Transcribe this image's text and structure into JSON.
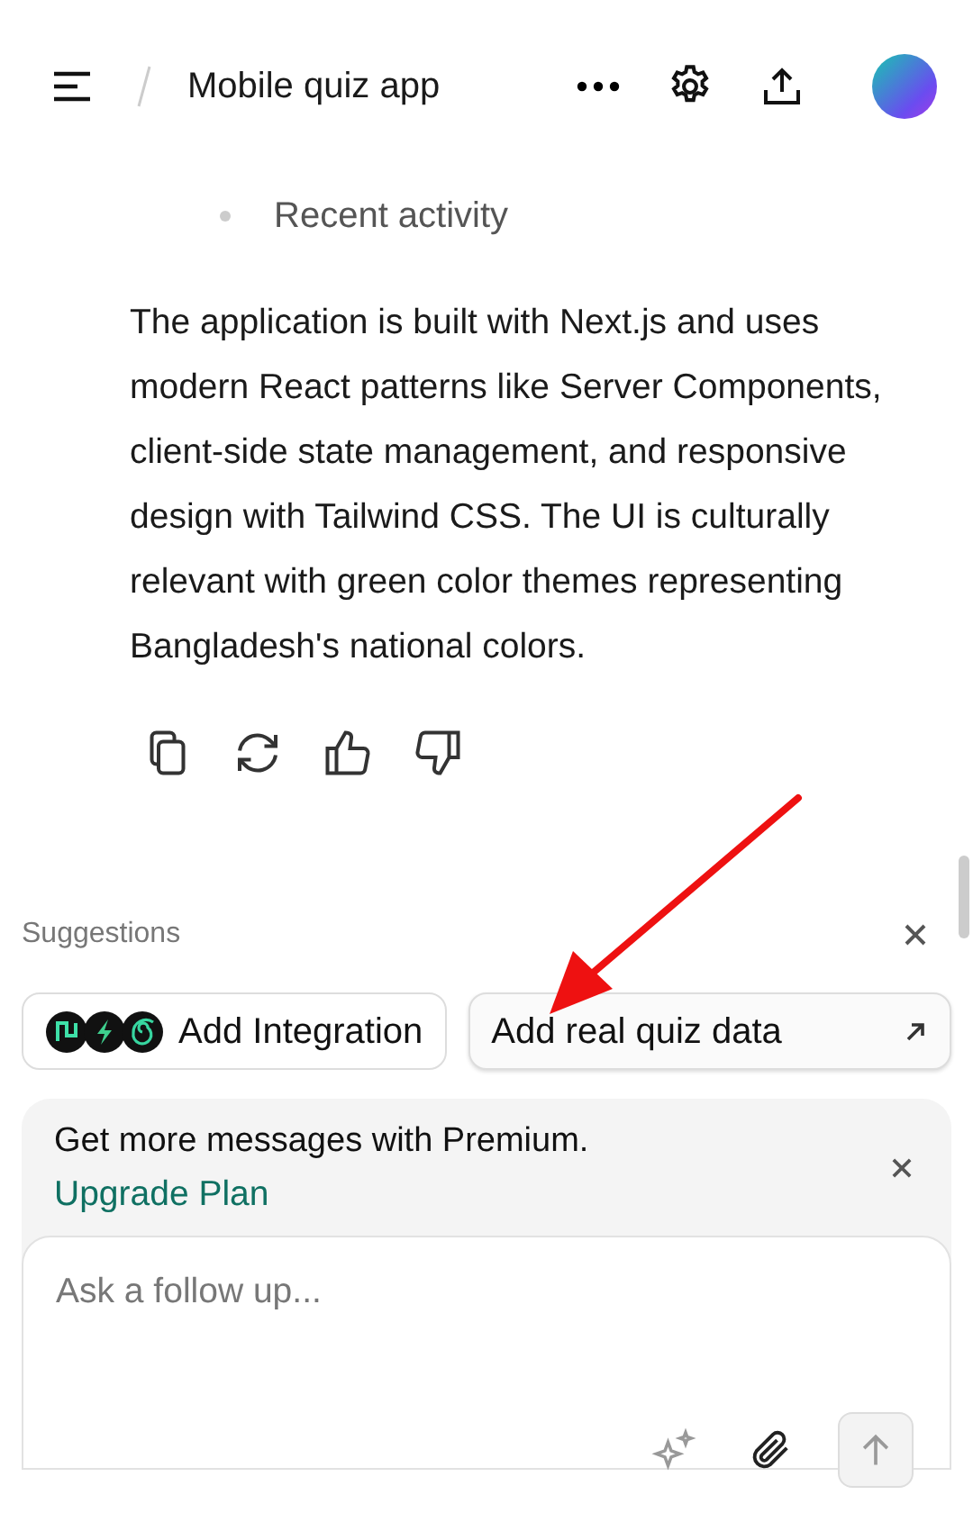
{
  "header": {
    "title": "Mobile quiz app"
  },
  "list_items": [
    "Recent activity"
  ],
  "paragraph": "The application is built with Next.js and uses modern React patterns like Server Components, client-side state management, and responsive design with Tailwind CSS. The UI is culturally relevant with green color themes representing Bangladesh's national colors.",
  "suggestions": {
    "label": "Suggestions",
    "chips": [
      {
        "kind": "integration",
        "label": "Add Integration"
      },
      {
        "kind": "prompt",
        "label": "Add real quiz data"
      }
    ]
  },
  "banner": {
    "text": "Get more messages with Premium.",
    "link": "Upgrade Plan"
  },
  "composer": {
    "placeholder": "Ask a follow up..."
  }
}
